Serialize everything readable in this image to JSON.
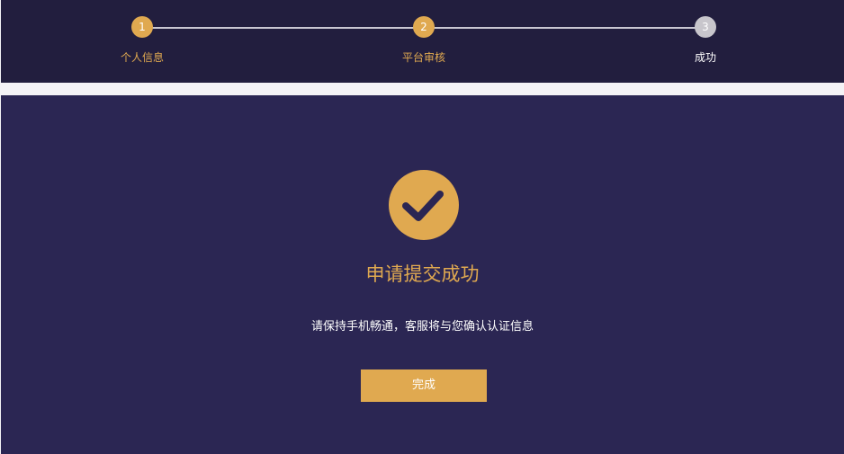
{
  "steps": [
    {
      "number": "1",
      "label": "个人信息",
      "state": "done"
    },
    {
      "number": "2",
      "label": "平台审核",
      "state": "done"
    },
    {
      "number": "3",
      "label": "成功",
      "state": "current"
    }
  ],
  "result": {
    "title": "申请提交成功",
    "message": "请保持手机畅通，客服将与您确认认证信息",
    "finish_label": "完成"
  },
  "colors": {
    "accent": "#e0a950",
    "header_bg": "#221e3e",
    "panel_bg": "#2b2653",
    "pending_dot": "#c8c6cc"
  },
  "icons": {
    "success": "check-icon"
  }
}
